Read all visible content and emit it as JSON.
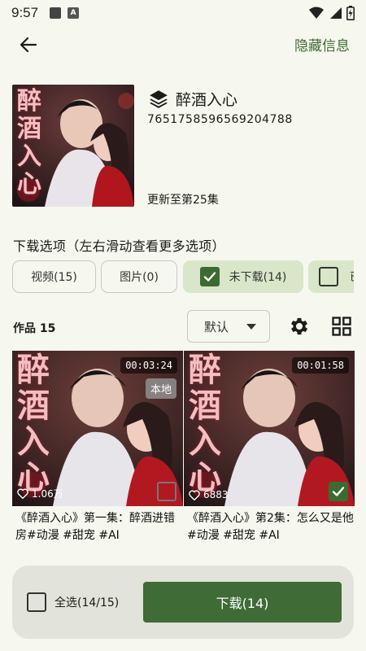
{
  "status_bar": {
    "time": "9:57"
  },
  "top_bar": {
    "hide_info_label": "隐藏信息"
  },
  "drama": {
    "title": "醉酒入心",
    "id": "7651758596569204788",
    "update_text": "更新至第25集",
    "cover_text": "醉酒入心"
  },
  "download_options": {
    "title": "下载选项（左右滑动查看更多选项）",
    "chips": [
      {
        "label": "视频(15)",
        "selected": false
      },
      {
        "label": "图片(0)",
        "selected": false
      },
      {
        "label": "未下载(14)",
        "selected": true
      },
      {
        "label": "已",
        "selected": false
      }
    ]
  },
  "works": {
    "label": "作品 15",
    "sort_value": "默认"
  },
  "cards": [
    {
      "duration": "00:03:24",
      "badge": "本地",
      "likes": "1.06万",
      "checked": false,
      "caption": "《醉酒入心》第一集：醉酒进错房#动漫 #甜宠 #AI"
    },
    {
      "duration": "00:01:58",
      "badge": "",
      "likes": "6883",
      "checked": true,
      "caption": "《醉酒入心》第2集：怎么又是他#动漫 #甜宠 #AI"
    }
  ],
  "bottom_bar": {
    "select_all_label": "全选(14/15)",
    "download_label": "下载(14)"
  },
  "colors": {
    "accent": "#3e6b36",
    "background": "#f6f7ee",
    "chip_selected": "#d9e6c9"
  }
}
